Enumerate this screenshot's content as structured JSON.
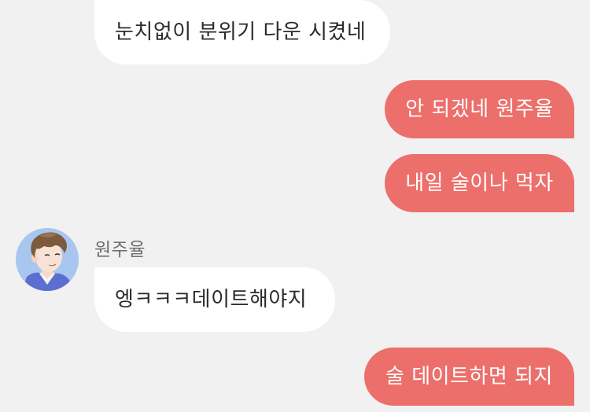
{
  "messages": [
    {
      "text": "눈치없이 분위기 다운 시켰네"
    },
    {
      "text": "안 되겠네 원주율"
    },
    {
      "text": "내일 술이나 먹자"
    },
    {
      "text": "엥ㅋㅋㅋ데이트해야지"
    },
    {
      "text": "술 데이트하면 되지"
    }
  ],
  "sender": {
    "name": "원주율"
  },
  "colors": {
    "background": "#f1f1f1",
    "incoming_bubble": "#ffffff",
    "outgoing_bubble": "#ec6f6b",
    "sender_name": "#6f6f6f"
  }
}
